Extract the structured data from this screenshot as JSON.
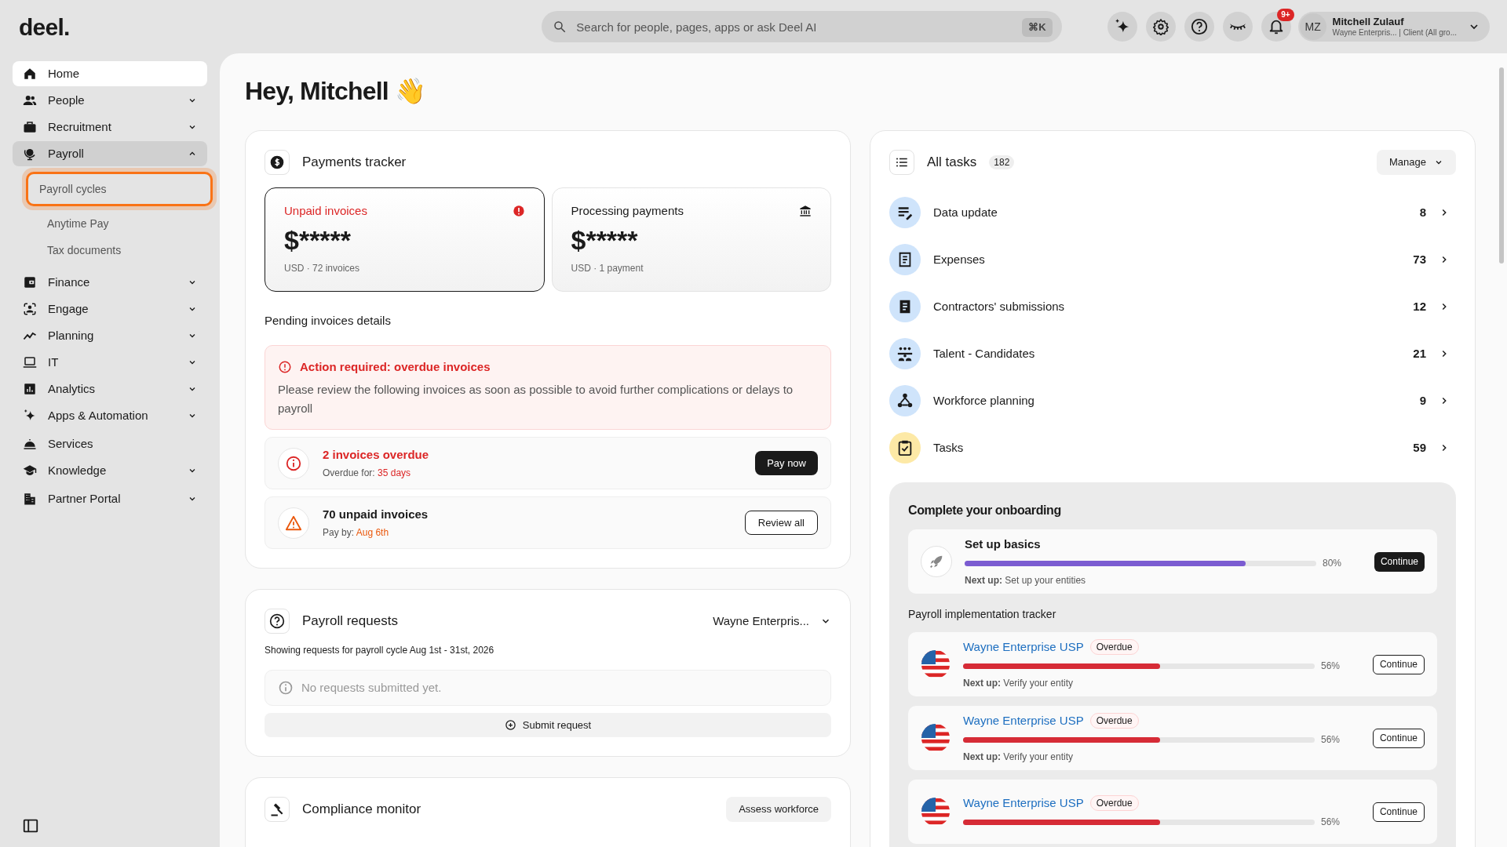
{
  "topbar": {
    "logo": "deel.",
    "search": {
      "placeholder": "Search for people, pages, apps or ask Deel AI",
      "shortcut": "⌘K"
    },
    "actions": [
      {
        "kind": "sparkle"
      },
      {
        "kind": "gear"
      },
      {
        "kind": "help"
      },
      {
        "kind": "eye-closed"
      },
      {
        "kind": "bell",
        "badge": "9+"
      }
    ],
    "user": {
      "initials": "MZ",
      "name": "Mitchell Zulauf",
      "subtitle": "Wayne Enterpris... | Client (All gro..."
    }
  },
  "sidebar": {
    "items": [
      {
        "label": "Home",
        "kind": "home",
        "selected": true
      },
      {
        "label": "People",
        "kind": "people",
        "selected": false,
        "expanded": false
      },
      {
        "label": "Recruitment",
        "kind": "briefcase",
        "selected": false,
        "expanded": false
      },
      {
        "label": "Payroll",
        "kind": "globe",
        "selected": false,
        "expanded": true,
        "children": [
          {
            "label": "Payroll cycles",
            "selected": true
          },
          {
            "label": "Anytime Pay",
            "selected": false
          },
          {
            "label": "Tax documents",
            "selected": false
          }
        ]
      },
      {
        "label": "Finance",
        "kind": "wallet",
        "selected": false,
        "expanded": false
      },
      {
        "label": "Engage",
        "kind": "engage",
        "selected": false,
        "expanded": false
      },
      {
        "label": "Planning",
        "kind": "trend",
        "selected": false,
        "expanded": false
      },
      {
        "label": "IT",
        "kind": "laptop",
        "selected": false,
        "expanded": false
      },
      {
        "label": "Analytics",
        "kind": "chart",
        "selected": false,
        "expanded": false
      },
      {
        "label": "Apps & Automation",
        "kind": "sparkle",
        "selected": false,
        "expanded": false
      },
      {
        "label": "Services",
        "kind": "service",
        "selected": false
      },
      {
        "label": "Knowledge",
        "kind": "cap",
        "selected": false,
        "expanded": false
      },
      {
        "label": "Partner Portal",
        "kind": "building",
        "selected": false,
        "expanded": false
      }
    ]
  },
  "greeting": "Hey, Mitchell 👋",
  "payments_tracker": {
    "title": "Payments tracker",
    "metrics": [
      {
        "label": "Unpaid invoices",
        "amount": "$*****",
        "detail": "USD · 72 invoices",
        "selected": true,
        "kind": "alert"
      },
      {
        "label": "Processing payments",
        "amount": "$*****",
        "detail": "USD · 1 payment",
        "selected": false,
        "kind": "bank"
      }
    ],
    "pending_title": "Pending invoices details",
    "alert": {
      "title": "Action required: overdue invoices",
      "text": "Please review the following invoices as soon as possible to avoid further complications or delays to payroll"
    },
    "rows": [
      {
        "kind": "overdue",
        "title": "2 invoices overdue",
        "meta_label": "Overdue for:",
        "meta_value": "35 days",
        "button": "Pay now"
      },
      {
        "kind": "unpaid",
        "title": "70 unpaid invoices",
        "meta_label": "Pay by:",
        "meta_value": "Aug 6th",
        "button": "Review all"
      }
    ]
  },
  "payroll_requests": {
    "title": "Payroll requests",
    "entity": "Wayne Enterpris...",
    "subtitle": "Showing requests for payroll cycle Aug 1st - 31st, 2026",
    "empty": "No requests submitted yet.",
    "button": "Submit request"
  },
  "compliance": {
    "title": "Compliance monitor",
    "button": "Assess workforce"
  },
  "tasks": {
    "title": "All tasks",
    "count": "182",
    "manage": "Manage",
    "items": [
      {
        "label": "Data update",
        "count": "8",
        "kind": "edit",
        "color": "#cfe4fb"
      },
      {
        "label": "Expenses",
        "count": "73",
        "kind": "receipt",
        "color": "#cfe4fb"
      },
      {
        "label": "Contractors' submissions",
        "count": "12",
        "kind": "submission",
        "color": "#cfe4fb"
      },
      {
        "label": "Talent - Candidates",
        "count": "21",
        "kind": "talent",
        "color": "#cfe4fb"
      },
      {
        "label": "Workforce planning",
        "count": "9",
        "kind": "planning",
        "color": "#cfe4fb"
      },
      {
        "label": "Tasks",
        "count": "59",
        "kind": "task",
        "color": "#fde9a6"
      }
    ]
  },
  "onboarding": {
    "title": "Complete your onboarding",
    "basics": {
      "title": "Set up basics",
      "level": 0.8,
      "reading": "80%",
      "next_label": "Next up:",
      "next": "Set up your entities",
      "button": "Continue"
    },
    "tracker_title": "Payroll implementation tracker",
    "trackers": [
      {
        "name": "Wayne Enterprise USP",
        "badge": "Overdue",
        "level": 0.56,
        "reading": "56%",
        "next_label": "Next up:",
        "next": "Verify your entity",
        "button": "Continue"
      },
      {
        "name": "Wayne Enterprise USP",
        "badge": "Overdue",
        "level": 0.56,
        "reading": "56%",
        "next_label": "Next up:",
        "next": "Verify your entity",
        "button": "Continue"
      },
      {
        "name": "Wayne Enterprise USP",
        "badge": "Overdue",
        "level": 0.56,
        "reading": "56%",
        "button": "Continue"
      }
    ]
  }
}
